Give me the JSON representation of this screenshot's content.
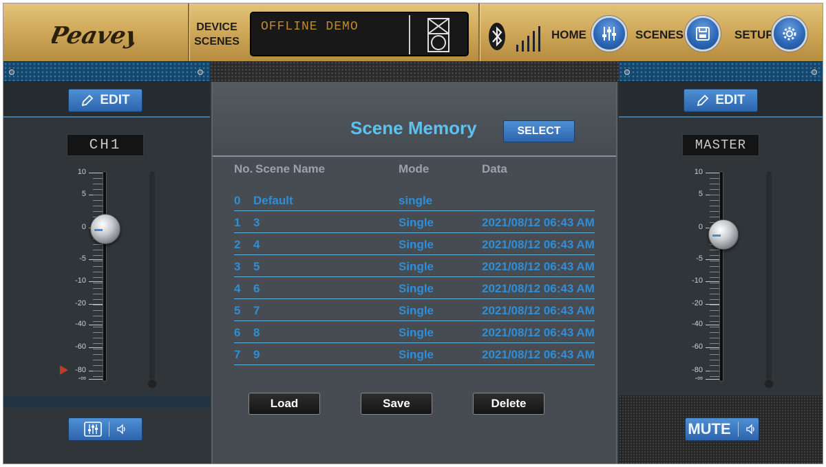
{
  "topbar": {
    "logo_text": "Peavey",
    "device_scenes_line1": "DEVICE",
    "device_scenes_line2": "SCENES",
    "display_text": "OFFLINE DEMO",
    "nav": [
      {
        "label": "HOME",
        "icon": "mixer-sliders-icon"
      },
      {
        "label": "SCENES",
        "icon": "save-disk-icon"
      },
      {
        "label": "SETUP",
        "icon": "gear-icon"
      }
    ]
  },
  "left_channel": {
    "edit_label": "EDIT",
    "channel_name": "CH1",
    "fader_scale": [
      "10",
      "5",
      "0",
      "-5",
      "-10",
      "-20",
      "-40",
      "-60",
      "-80",
      "-∞"
    ],
    "fader_level_db": 0
  },
  "master_channel": {
    "edit_label": "EDIT",
    "channel_name": "MASTER",
    "fader_scale": [
      "10",
      "5",
      "0",
      "-5",
      "-10",
      "-20",
      "-40",
      "-60",
      "-80",
      "-∞"
    ],
    "fader_level_db": -1,
    "mute_label": "MUTE"
  },
  "scene_memory": {
    "title": "Scene Memory",
    "select_label": "SELECT",
    "columns": {
      "no": "No.",
      "name": "Scene Name",
      "mode": "Mode",
      "data": "Data"
    },
    "rows": [
      {
        "no": "0",
        "name": "Default",
        "mode": "single",
        "data": ""
      },
      {
        "no": "1",
        "name": "3",
        "mode": "Single",
        "data": "2021/08/12 06:43 AM"
      },
      {
        "no": "2",
        "name": "4",
        "mode": "Single",
        "data": "2021/08/12 06:43 AM"
      },
      {
        "no": "3",
        "name": "5",
        "mode": "Single",
        "data": "2021/08/12 06:43 AM"
      },
      {
        "no": "4",
        "name": "6",
        "mode": "Single",
        "data": "2021/08/12 06:43 AM"
      },
      {
        "no": "5",
        "name": "7",
        "mode": "Single",
        "data": "2021/08/12 06:43 AM"
      },
      {
        "no": "6",
        "name": "8",
        "mode": "Single",
        "data": "2021/08/12 06:43 AM"
      },
      {
        "no": "7",
        "name": "9",
        "mode": "Single",
        "data": "2021/08/12 06:43 AM"
      }
    ],
    "buttons": {
      "load": "Load",
      "save": "Save",
      "delete": "Delete"
    }
  },
  "colors": {
    "accent_blue": "#2f8fd6",
    "title_blue": "#5cc2f2",
    "gold": "#cfa759"
  }
}
